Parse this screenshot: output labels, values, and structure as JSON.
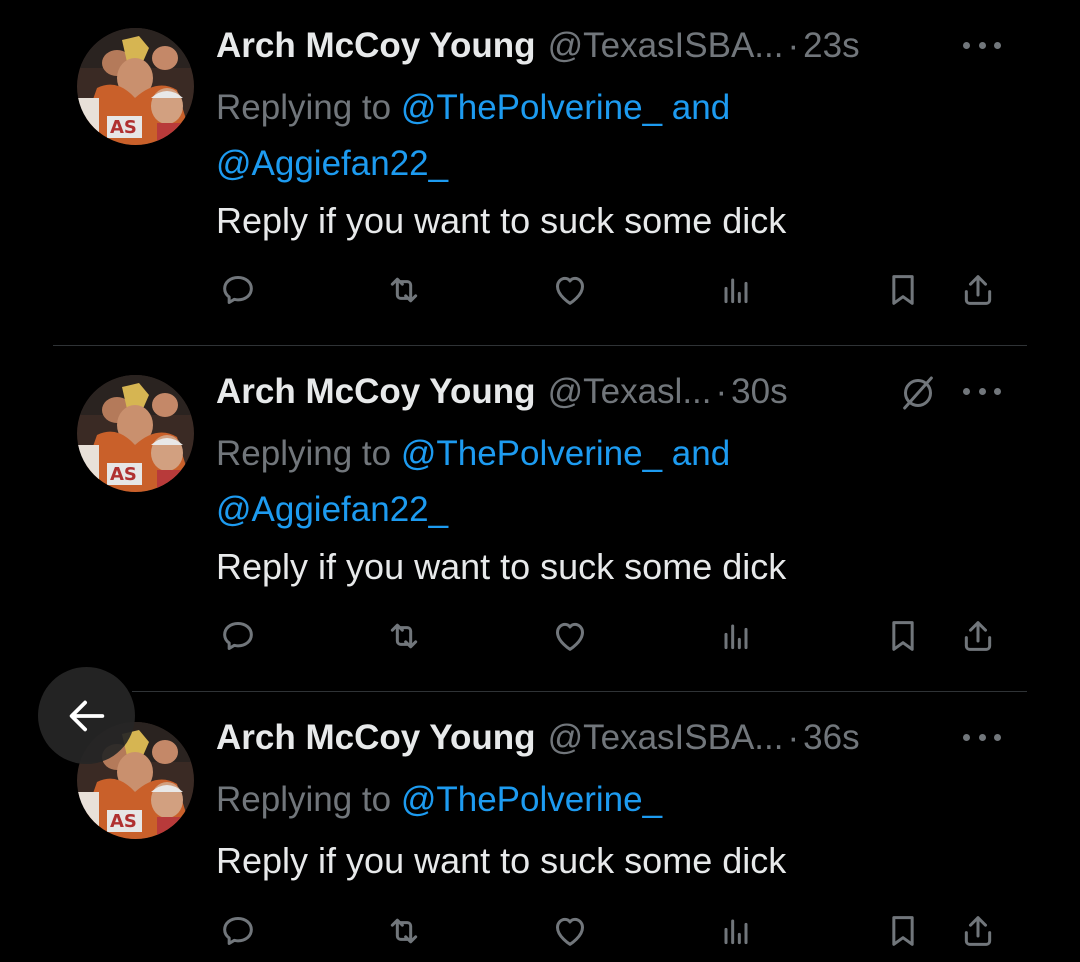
{
  "tweets": [
    {
      "name": "Arch McCoy Young",
      "handle": "@TexasISBA...",
      "separator": "·",
      "time": "23s",
      "replying_prefix": "Replying to ",
      "replying_mentions": "@ThePolverine_ and @Aggiefan22_",
      "text": "Reply if you want to suck some dick"
    },
    {
      "name": "Arch McCoy Young",
      "handle": "@Texasl...",
      "separator": "·",
      "time": "30s",
      "replying_prefix": "Replying to ",
      "replying_mentions": "@ThePolverine_ and @Aggiefan22_",
      "text": "Reply if you want to suck some dick"
    },
    {
      "name": "Arch McCoy Young",
      "handle": "@TexasISBA...",
      "separator": "·",
      "time": "36s",
      "replying_prefix": "Replying to ",
      "replying_mentions": "@ThePolverine_",
      "text": "Reply if you want to suck some dick"
    }
  ],
  "icons": {
    "actions": [
      "reply-icon",
      "retweet-icon",
      "like-icon",
      "views-icon",
      "bookmark-icon",
      "share-icon"
    ],
    "more": "more-options-icon",
    "grok": "grok-icon",
    "back": "back-arrow-icon"
  },
  "colors": {
    "background": "#000000",
    "text_primary": "#e7e9ea",
    "text_secondary": "#71767b",
    "link": "#1d9bf0",
    "divider": "#2f3336"
  }
}
